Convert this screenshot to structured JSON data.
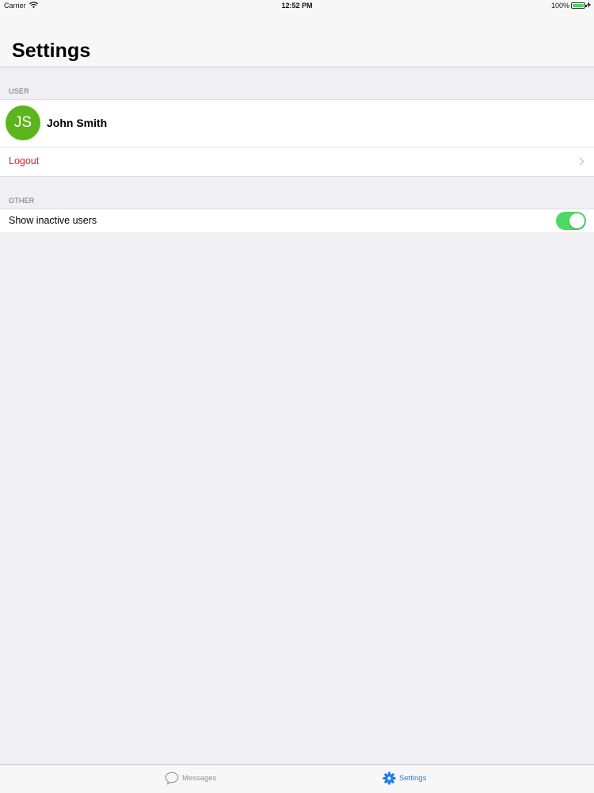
{
  "status_bar": {
    "carrier": "Carrier",
    "time": "12:52 PM",
    "battery": "100%",
    "battery_level": 1.0
  },
  "nav": {
    "title": "Settings"
  },
  "sections": {
    "user": {
      "header": "USER",
      "avatar_initials": "JS",
      "avatar_color": "#5cb51c",
      "name": "John Smith",
      "logout_label": "Logout"
    },
    "other": {
      "header": "OTHER",
      "show_inactive_label": "Show inactive users",
      "show_inactive_on": true
    }
  },
  "tab_bar": {
    "messages": {
      "label": "Messages",
      "icon": "speech-bubble-icon",
      "active": false
    },
    "settings": {
      "label": "Settings",
      "icon": "gear-icon",
      "active": true
    }
  },
  "colors": {
    "accent": "#1b7cf6",
    "destructive": "#e0201e",
    "toggle_on": "#4cd964",
    "background": "#efeff4"
  }
}
